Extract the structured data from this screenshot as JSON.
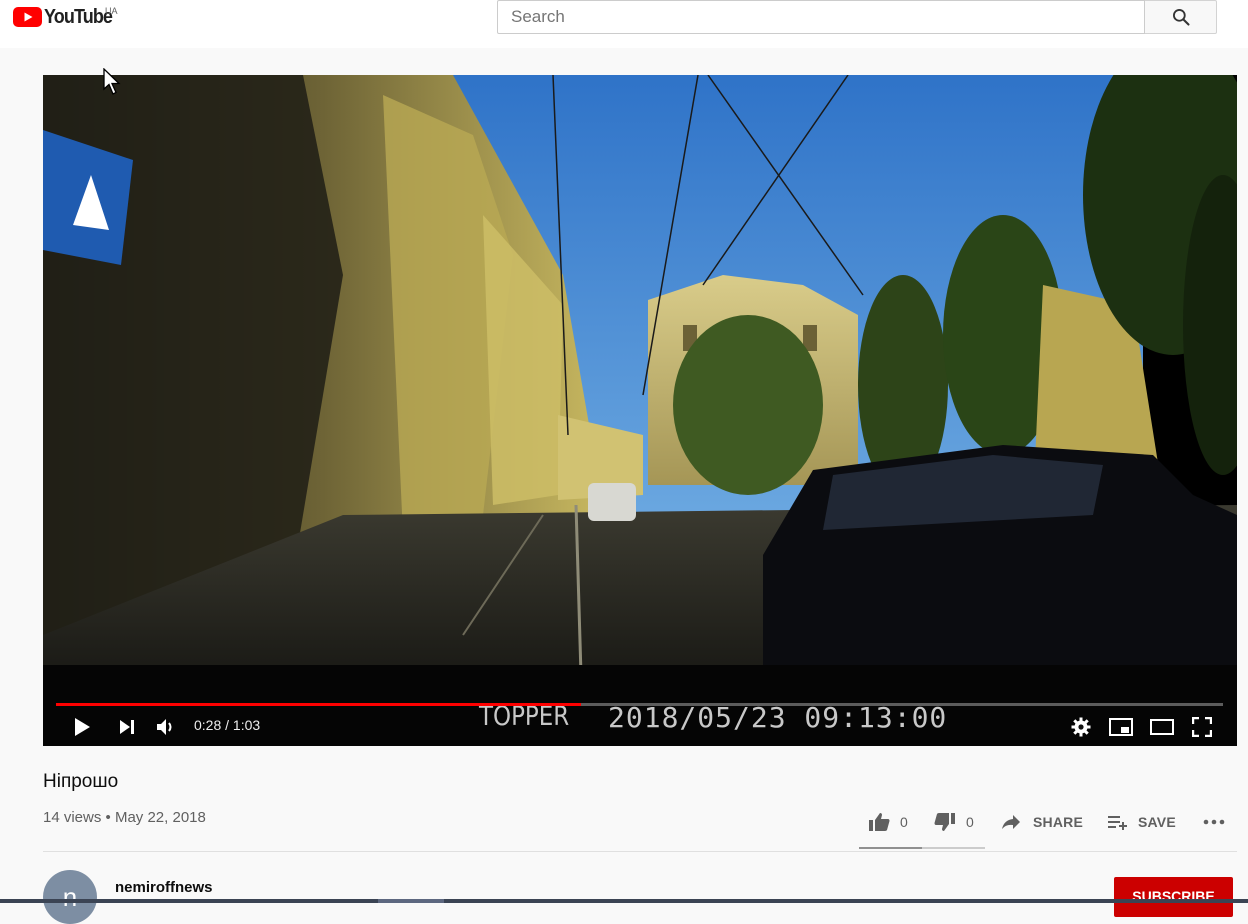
{
  "masthead": {
    "logo_text": "YouTube",
    "region": "UA",
    "search_placeholder": "Search"
  },
  "player": {
    "time": "0:28 / 1:03",
    "progress_fraction": 0.45,
    "overlay_brand": "TOPPER",
    "overlay_datetime": "2018/05/23 09:13:00"
  },
  "video": {
    "title": "Нiпрошо",
    "meta": "14 views • May 22, 2018"
  },
  "actions": {
    "likes": "0",
    "dislikes": "0",
    "share": "SHARE",
    "save": "SAVE"
  },
  "channel": {
    "avatar_letter": "n",
    "name": "nemiroffnews",
    "subscribe": "SUBSCRIBE"
  },
  "colors": {
    "accent": "#ff0000",
    "subscribe": "#cc0000"
  },
  "icons": [
    "youtube-logo-icon",
    "search-icon",
    "play-icon",
    "next-icon",
    "volume-icon",
    "settings-icon",
    "miniplayer-icon",
    "theater-icon",
    "fullscreen-icon",
    "thumb-up-icon",
    "thumb-down-icon",
    "share-icon",
    "playlist-add-icon",
    "more-icon",
    "cursor-icon"
  ]
}
